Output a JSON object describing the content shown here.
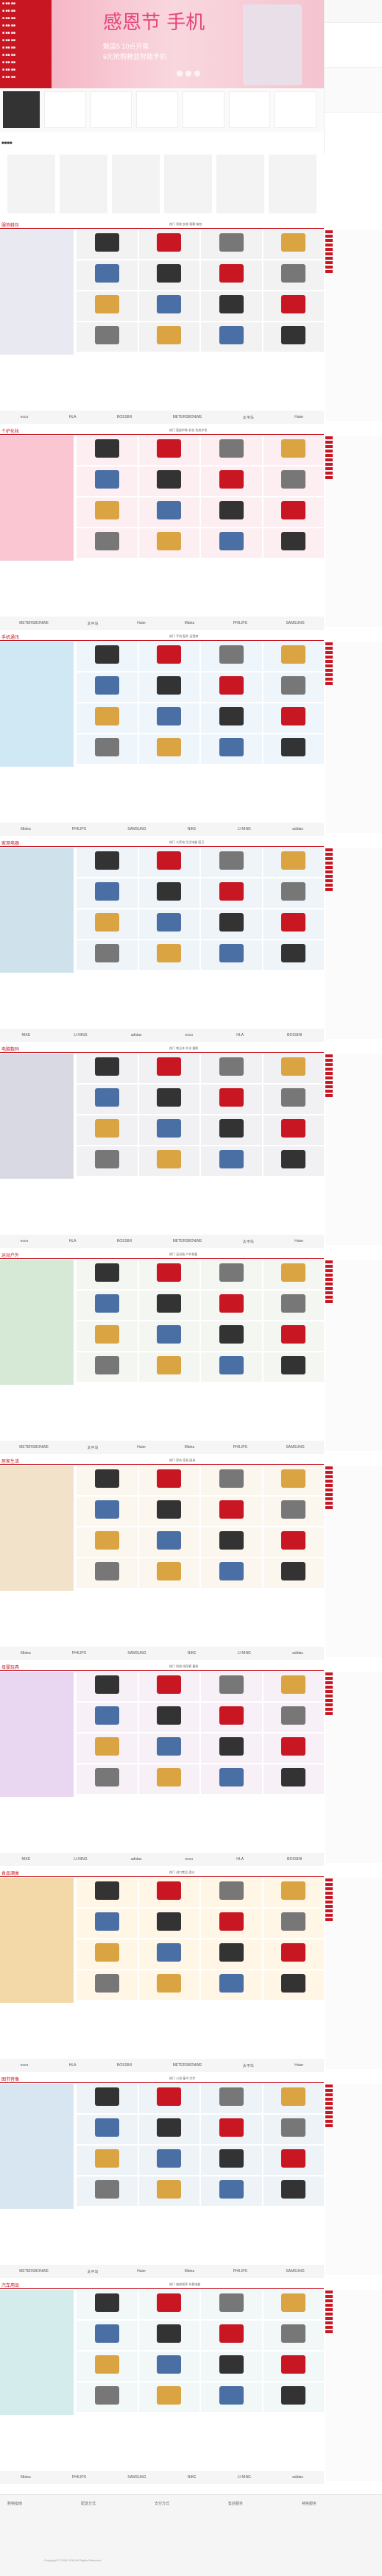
{
  "hero": {
    "line1": "感恩节",
    "line2": "手机",
    "sub1": "魅蓝5 10点开售",
    "sub2": "6元抢购魅蓝智能手机"
  },
  "floors": [
    {
      "label": "服饰鞋包",
      "tabs": "热门 男装 女装 鞋靴 箱包"
    },
    {
      "label": "个护化妆",
      "tabs": "热门 面部护肤 彩妆 洗发护发"
    },
    {
      "label": "手机通讯",
      "tabs": "热门 手机 配件 运营商"
    },
    {
      "label": "家用电器",
      "tabs": "热门 大家电 生活电器 厨卫"
    },
    {
      "label": "电脑数码",
      "tabs": "热门 笔记本 外设 摄影"
    },
    {
      "label": "运动户外",
      "tabs": "热门 运动鞋 户外装备"
    },
    {
      "label": "居家生活",
      "tabs": "热门 家纺 家具 厨具"
    },
    {
      "label": "母婴玩具",
      "tabs": "热门 奶粉 纸尿裤 童装"
    },
    {
      "label": "食品酒类",
      "tabs": "热门 进口食品 酒水"
    },
    {
      "label": "图书音像",
      "tabs": "热门 小说 童书 文学"
    },
    {
      "label": "汽车用品",
      "tabs": "热门 维修保养 车载电器"
    }
  ],
  "brands": [
    "ecco",
    "HLA",
    "BOSSINI",
    "METERSBONWE",
    "太平鸟",
    "Haier",
    "Midea",
    "PHILIPS",
    "SAMSUNG",
    "NIKE",
    "LI-NING",
    "adidas"
  ],
  "footer": {
    "cols": [
      "购物指南",
      "配送方式",
      "支付方式",
      "售后服务",
      "特色服务"
    ],
    "copyright": "Copyright © 2004-2016 All Rights Reserved"
  },
  "colors": {
    "accent": "#c81623"
  }
}
